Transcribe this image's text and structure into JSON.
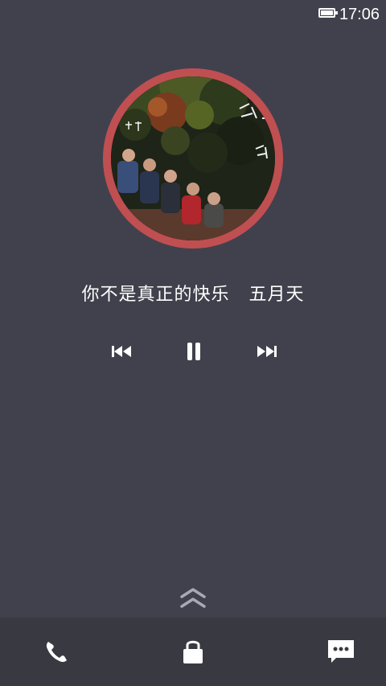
{
  "status_bar": {
    "time": "17:06",
    "battery_icon": "battery-full-icon"
  },
  "player": {
    "song_title": "你不是真正的快乐",
    "artist": "五月天",
    "state": "playing",
    "album_ring_color": "#c04f52",
    "controls": {
      "prev_icon": "skip-previous-icon",
      "pause_icon": "pause-icon",
      "next_icon": "skip-next-icon"
    }
  },
  "swipe_hint_icon": "chevron-double-up-icon",
  "bottom_bar": {
    "items": [
      {
        "icon": "phone-icon"
      },
      {
        "icon": "lock-icon"
      },
      {
        "icon": "message-icon"
      }
    ]
  },
  "colors": {
    "background": "#41414d",
    "bottom_bar": "#393942",
    "icon": "#ffffff"
  }
}
